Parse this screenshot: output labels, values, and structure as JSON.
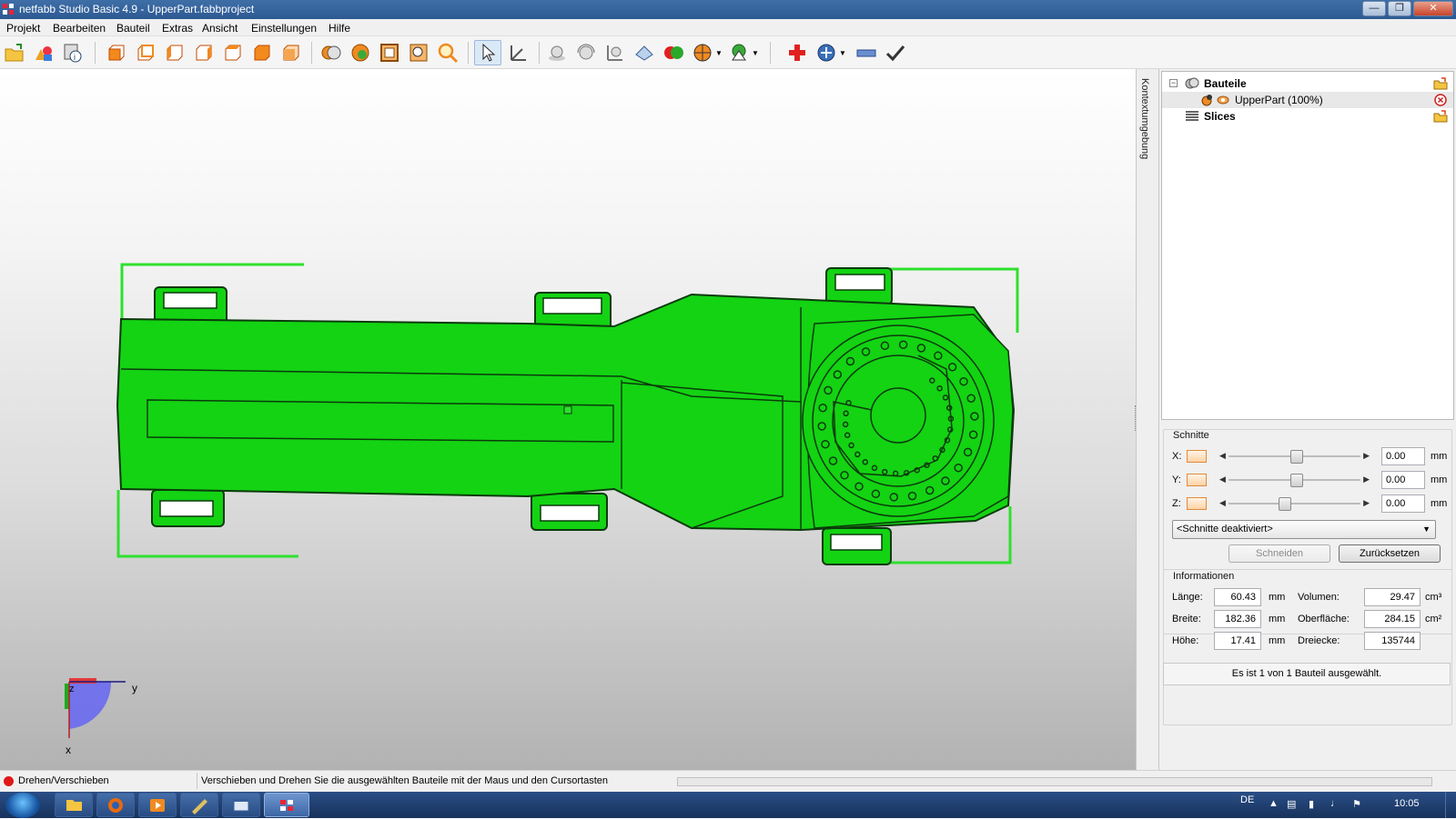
{
  "window": {
    "title": "netfabb Studio Basic 4.9 - UpperPart.fabbproject",
    "controls": [
      "minimize",
      "maximize",
      "close"
    ]
  },
  "menu": [
    "Projekt",
    "Bearbeiten",
    "Bauteil",
    "Extras",
    "Ansicht",
    "Einstellungen",
    "Hilfe"
  ],
  "toolbar_icons": [
    "open-project-icon",
    "add-part-icon",
    "part-info-icon",
    "view-front-icon",
    "view-back-icon",
    "view-left-icon",
    "view-right-icon",
    "view-top-icon",
    "view-bottom-icon",
    "view-iso-icon",
    "render-mode-icon",
    "sphere-view-icon",
    "frame-view-icon",
    "zoom-selection-icon",
    "zoom-icon",
    "select-tool-icon",
    "axis-tool-icon",
    "move-icon",
    "rotate-icon",
    "scale-icon",
    "transform-icon",
    "boolean-icon",
    "slice-icon",
    "measure-icon",
    "repair-cross-icon",
    "shell-icon",
    "ruler-icon",
    "check-icon"
  ],
  "viewport": {
    "model_color": "#12d312",
    "axis": {
      "y": "y",
      "x": "x",
      "z": "z"
    }
  },
  "side_tab": "Kontextumgebung",
  "tree": {
    "bauteile": "Bauteile",
    "part": "UpperPart (100%)",
    "slices": "Slices"
  },
  "schnitte": {
    "heading": "Schnitte",
    "axes": [
      {
        "label": "X:",
        "value": "0.00",
        "unit": "mm",
        "pos": 0.52
      },
      {
        "label": "Y:",
        "value": "0.00",
        "unit": "mm",
        "pos": 0.52
      },
      {
        "label": "Z:",
        "value": "0.00",
        "unit": "mm",
        "pos": 0.42
      }
    ],
    "mode": "<Schnitte deaktiviert>",
    "cut_button": "Schneiden",
    "reset_button": "Zurücksetzen"
  },
  "info": {
    "heading": "Informationen",
    "laenge_label": "Länge:",
    "laenge": "60.43",
    "laenge_unit": "mm",
    "breite_label": "Breite:",
    "breite": "182.36",
    "breite_unit": "mm",
    "hoehe_label": "Höhe:",
    "hoehe": "17.41",
    "hoehe_unit": "mm",
    "volumen_label": "Volumen:",
    "volumen": "29.47",
    "volumen_unit": "cm³",
    "oberflaeche_label": "Oberfläche:",
    "oberflaeche": "284.15",
    "oberflaeche_unit": "cm²",
    "dreiecke_label": "Dreiecke:",
    "dreiecke": "135744"
  },
  "selection_status": "Es ist 1 von 1 Bauteil ausgewählt.",
  "status": {
    "mode": "Drehen/Verschieben",
    "hint": "Verschieben und Drehen Sie die ausgewählten Bauteile mit der Maus und den Cursortasten"
  },
  "taskbar": {
    "apps": [
      "explorer-icon",
      "firefox-icon",
      "media-player-icon",
      "sketch-app-icon",
      "window-app-icon",
      "netfabb-icon"
    ],
    "language": "DE",
    "time": "10:05"
  }
}
